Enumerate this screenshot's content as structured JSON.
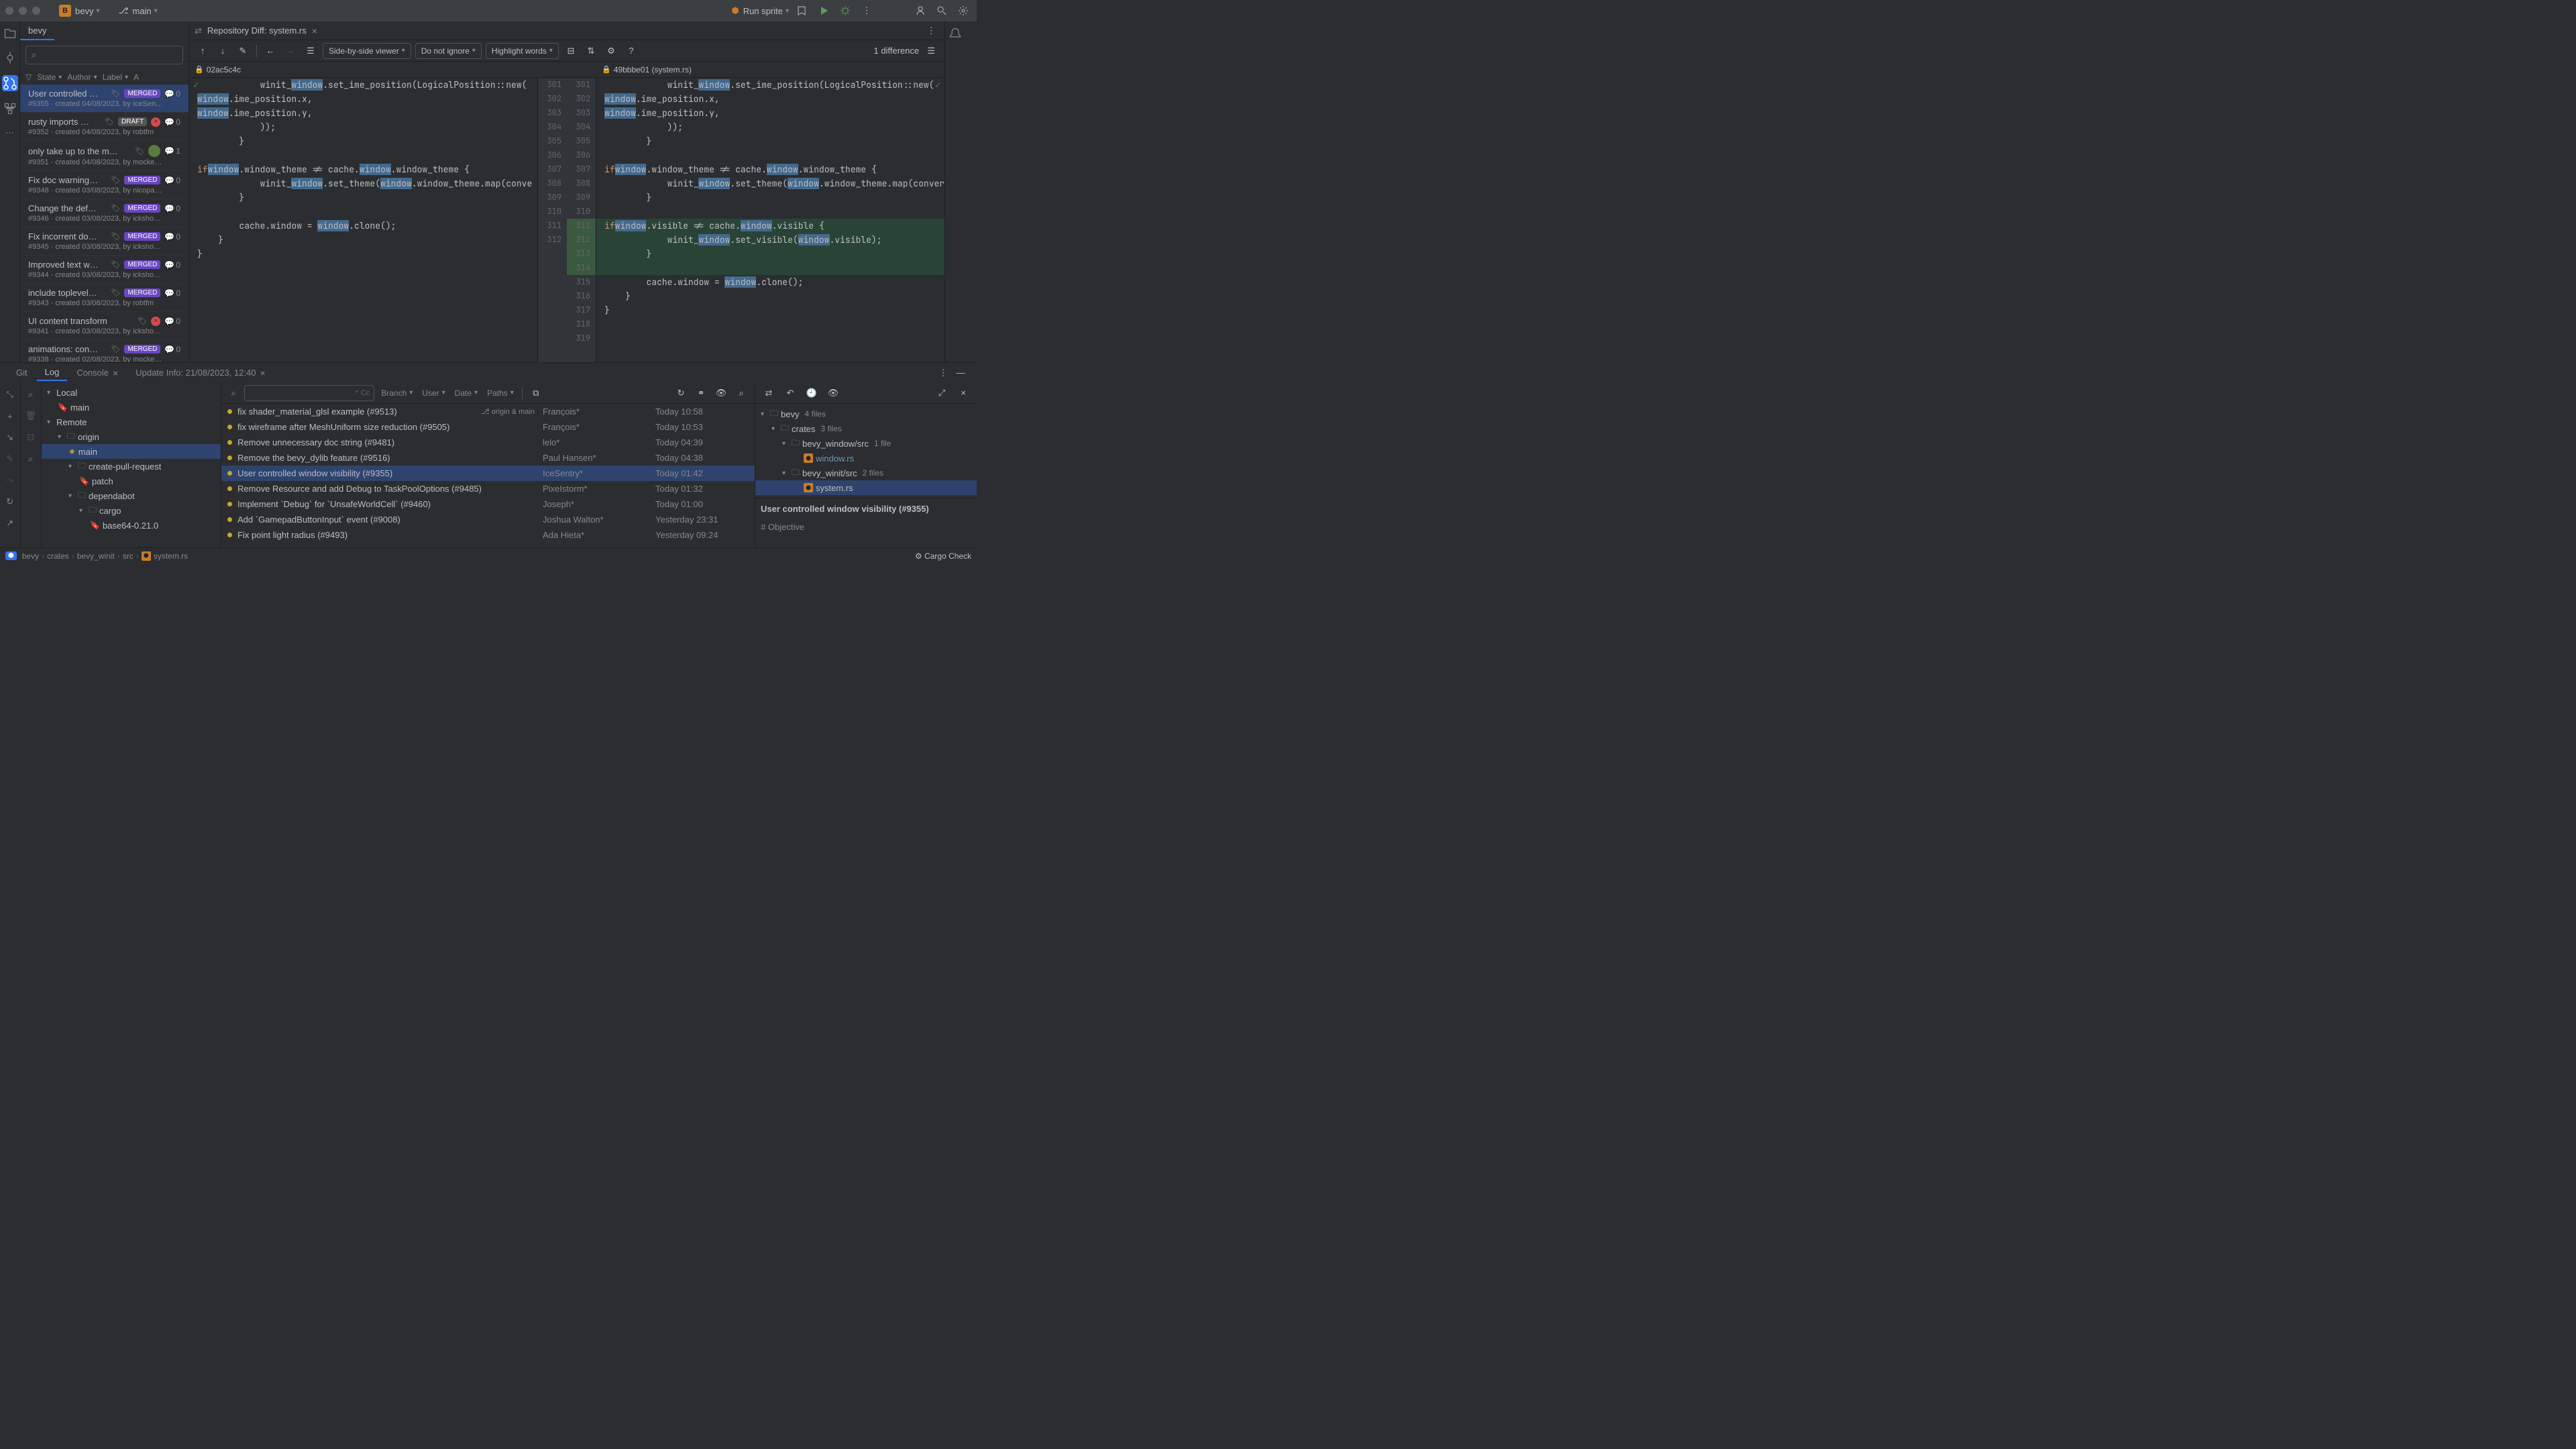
{
  "title_bar": {
    "project_badge": "B",
    "project_name": "bevy",
    "branch": "main",
    "run_config": "Run sprite"
  },
  "pr_panel": {
    "tab": "bevy",
    "filters": {
      "state": "State",
      "author": "Author",
      "label": "Label",
      "assignee": "A"
    },
    "items": [
      {
        "title": "User controlled …",
        "tag": "MERGED",
        "comments": "0",
        "meta": "#9355 · created 04/08/2023, by IceSen…"
      },
      {
        "title": "rusty imports …",
        "tag": "DRAFT",
        "comments": "0",
        "meta": "#9352 · created 04/08/2023, by robtfm",
        "failed": true
      },
      {
        "title": "only take up to the m…",
        "tag": "",
        "comments": "1",
        "meta": "#9351 · created 04/08/2023, by mocke…",
        "avatar": true
      },
      {
        "title": "Fix doc warning…",
        "tag": "MERGED",
        "comments": "0",
        "meta": "#9348 · created 03/08/2023, by nicopa…"
      },
      {
        "title": "Change the def…",
        "tag": "MERGED",
        "comments": "0",
        "meta": "#9346 · created 03/08/2023, by icksho…"
      },
      {
        "title": "Fix incorrent do…",
        "tag": "MERGED",
        "comments": "0",
        "meta": "#9345 · created 03/08/2023, by icksho…"
      },
      {
        "title": "Improved text w…",
        "tag": "MERGED",
        "comments": "0",
        "meta": "#9344 · created 03/08/2023, by icksho…"
      },
      {
        "title": "include toplevel…",
        "tag": "MERGED",
        "comments": "0",
        "meta": "#9343 · created 03/08/2023, by robtfm"
      },
      {
        "title": "UI content transform",
        "tag": "",
        "comments": "0",
        "meta": "#9341 · created 03/08/2023, by icksho…",
        "failed": true
      },
      {
        "title": "animations: con…",
        "tag": "MERGED",
        "comments": "0",
        "meta": "#9338 · created 02/08/2023, by mocke…"
      }
    ]
  },
  "diff": {
    "tab_label": "Repository Diff: system.rs",
    "viewer_mode": "Side-by-side viewer",
    "ignore_mode": "Do not ignore",
    "highlight_mode": "Highlight words",
    "diff_count": "1 difference",
    "left_hash": "02ac5c4c",
    "right_hash": "49bbbe01 (system.rs)",
    "gutter": [
      [
        "301",
        "301"
      ],
      [
        "302",
        "302"
      ],
      [
        "303",
        "303"
      ],
      [
        "304",
        "304"
      ],
      [
        "305",
        "305"
      ],
      [
        "306",
        "306"
      ],
      [
        "307",
        "307"
      ],
      [
        "308",
        "308"
      ],
      [
        "309",
        "309"
      ],
      [
        "310",
        "310"
      ],
      [
        "311",
        "311"
      ],
      [
        "312",
        "312"
      ],
      [
        "",
        "313"
      ],
      [
        "",
        "314"
      ],
      [
        "",
        "315"
      ],
      [
        "",
        "316"
      ],
      [
        "",
        "317"
      ],
      [
        "",
        "318"
      ],
      [
        "",
        "319"
      ]
    ]
  },
  "bottom_tabs": {
    "git": "Git",
    "log": "Log",
    "console": "Console",
    "update": "Update Info: 21/08/2023, 12:40"
  },
  "git_tree": {
    "local": "Local",
    "local_branches": [
      "main"
    ],
    "remote": "Remote",
    "origin": "origin",
    "origin_main": "main",
    "folders": [
      {
        "name": "create-pull-request",
        "children": [
          "patch"
        ]
      },
      {
        "name": "dependabot",
        "children": []
      },
      {
        "name": "cargo",
        "children": [
          "base64-0.21.0"
        ]
      }
    ]
  },
  "commits": {
    "filters": {
      "branch": "Branch",
      "user": "User",
      "date": "Date",
      "paths": "Paths"
    },
    "origin_label": "origin & main",
    "rows": [
      {
        "msg": "fix shader_material_glsl example (#9513)",
        "author": "François*",
        "date": "Today 10:58",
        "head": true
      },
      {
        "msg": "fix wireframe after MeshUniform size reduction (#9505)",
        "author": "François*",
        "date": "Today 10:53"
      },
      {
        "msg": "Remove unnecessary doc string (#9481)",
        "author": "lelo*",
        "date": "Today 04:39"
      },
      {
        "msg": "Remove the bevy_dylib feature (#9516)",
        "author": "Paul Hansen*",
        "date": "Today 04:38"
      },
      {
        "msg": "User controlled window visibility (#9355)",
        "author": "IceSentry*",
        "date": "Today 01:42",
        "sel": true
      },
      {
        "msg": "Remove Resource and add Debug to TaskPoolOptions (#9485)",
        "author": "PixeIstorm*",
        "date": "Today 01:32"
      },
      {
        "msg": "Implement `Debug` for `UnsafeWorldCell` (#9460)",
        "author": "Joseph*",
        "date": "Today 01:00"
      },
      {
        "msg": "Add `GamepadButtonInput` event (#9008)",
        "author": "Joshua Walton*",
        "date": "Yesterday 23:31"
      },
      {
        "msg": "Fix point light radius (#9493)",
        "author": "Ada Hieta*",
        "date": "Yesterday 09:24"
      }
    ]
  },
  "detail": {
    "root": "bevy",
    "root_count": "4 files",
    "crates": "crates",
    "crates_count": "3 files",
    "bevy_window": "bevy_window/src",
    "bevy_window_count": "1 file",
    "window_rs": "window.rs",
    "bevy_winit": "bevy_winit/src",
    "bevy_winit_count": "2 files",
    "system_rs": "system.rs",
    "commit_title": "User controlled window visibility (#9355)",
    "commit_body": "# Objective"
  },
  "status_bar": {
    "crumbs": [
      "bevy",
      "crates",
      "bevy_winit",
      "src",
      "system.rs"
    ],
    "cargo": "Cargo Check"
  }
}
